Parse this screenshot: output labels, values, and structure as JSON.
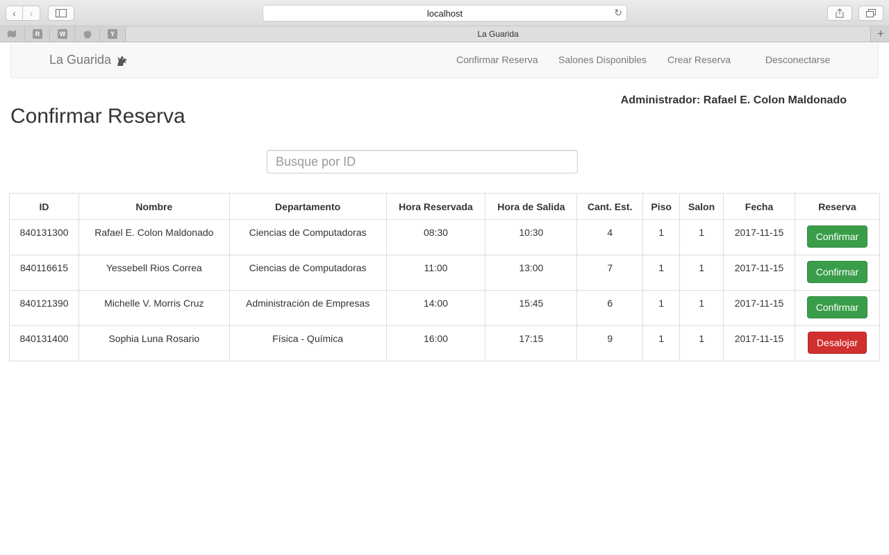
{
  "browser": {
    "url": "localhost",
    "tab_title": "La Guarida",
    "bookmarks": [
      "R",
      "W",
      "Y"
    ]
  },
  "navbar": {
    "brand": "La Guarida",
    "links": [
      "Confirmar Reserva",
      "Salones Disponibles",
      "Crear Reserva",
      "Desconectarse"
    ]
  },
  "admin_label": "Administrador: Rafael E. Colon Maldonado",
  "page_title": "Confirmar Reserva",
  "search": {
    "placeholder": "Busque por ID",
    "value": ""
  },
  "table": {
    "headers": [
      "ID",
      "Nombre",
      "Departamento",
      "Hora Reservada",
      "Hora de Salida",
      "Cant. Est.",
      "Piso",
      "Salon",
      "Fecha",
      "Reserva"
    ],
    "rows": [
      {
        "id": "840131300",
        "nombre": "Rafael E. Colon Maldonado",
        "departamento": "Ciencias de Computadoras",
        "hora_reservada": "08:30",
        "hora_salida": "10:30",
        "cant_est": "4",
        "piso": "1",
        "salon": "1",
        "fecha": "2017-11-15",
        "action": "Confirmar"
      },
      {
        "id": "840116615",
        "nombre": "Yessebell Rios Correa",
        "departamento": "Ciencias de Computadoras",
        "hora_reservada": "11:00",
        "hora_salida": "13:00",
        "cant_est": "7",
        "piso": "1",
        "salon": "1",
        "fecha": "2017-11-15",
        "action": "Confirmar"
      },
      {
        "id": "840121390",
        "nombre": "Michelle V. Morris Cruz",
        "departamento": "Administración de Empresas",
        "hora_reservada": "14:00",
        "hora_salida": "15:45",
        "cant_est": "6",
        "piso": "1",
        "salon": "1",
        "fecha": "2017-11-15",
        "action": "Confirmar"
      },
      {
        "id": "840131400",
        "nombre": "Sophia Luna Rosario",
        "departamento": "Física - Química",
        "hora_reservada": "16:00",
        "hora_salida": "17:15",
        "cant_est": "9",
        "piso": "1",
        "salon": "1",
        "fecha": "2017-11-15",
        "action": "Desalojar"
      }
    ]
  },
  "colors": {
    "confirm": "#3a9d4a",
    "evict": "#d0302f",
    "nav_text": "#777777"
  }
}
